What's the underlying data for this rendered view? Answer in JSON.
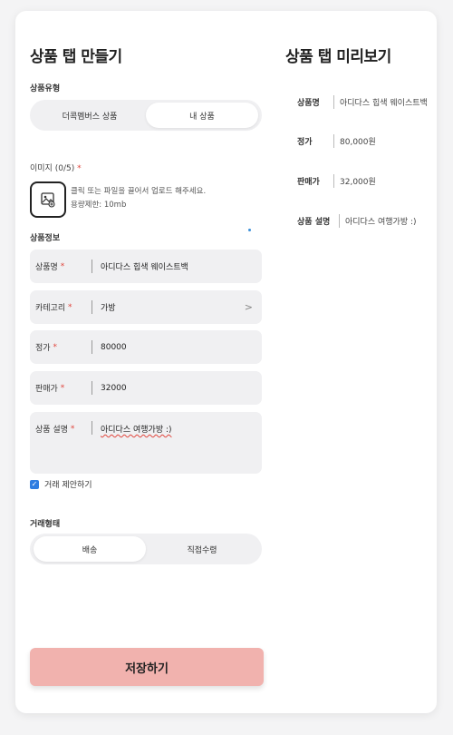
{
  "form": {
    "title": "상품 탭 만들기",
    "product_type_label": "상품유형",
    "product_type_options": [
      "더콕멤버스 상품",
      "내 상품"
    ],
    "image_label": "이미지 (0/5)",
    "image_required": "*",
    "upload_text_1": "클릭 또는 파일을 끌어서 업로드 해주세요.",
    "upload_text_2": "용량제한: 10mb",
    "product_info_label": "상품정보",
    "fields": [
      {
        "label": "상품명",
        "required": "*",
        "value": "아디다스 힙색 웨이스트백"
      },
      {
        "label": "카테고리",
        "required": "*",
        "value": "가방",
        "chevron": ">"
      },
      {
        "label": "정가",
        "required": "*",
        "value": "80000"
      },
      {
        "label": "판매가",
        "required": "*",
        "value": "32000"
      },
      {
        "label": "상품 설명",
        "required": "*",
        "value": "아디다스 여행가방 :)"
      }
    ],
    "trade_offer_label": "거래 제안하기",
    "trade_offer_checked": true,
    "trade_type_label": "거래형태",
    "trade_type_options": [
      "배송",
      "직접수령"
    ],
    "save_label": "저장하기"
  },
  "preview": {
    "title": "상품 탭 미리보기",
    "rows": [
      {
        "label": "상품명",
        "value": "아디다스 힙색 웨이스트백"
      },
      {
        "label": "정가",
        "value": "80,000원"
      },
      {
        "label": "판매가",
        "value": "32,000원"
      },
      {
        "label": "상품 설명",
        "value": "아디다스 여행가방 :)"
      }
    ]
  },
  "colors": {
    "accent_required": "#e0453c",
    "save_button": "#f1b2ae",
    "checkbox": "#2f7de1",
    "field_background": "#f0f0f2"
  },
  "icons": {
    "upload": "image-upload-icon",
    "category_chevron": "chevron-right-icon",
    "checkbox": "checkbox-checked-icon"
  }
}
